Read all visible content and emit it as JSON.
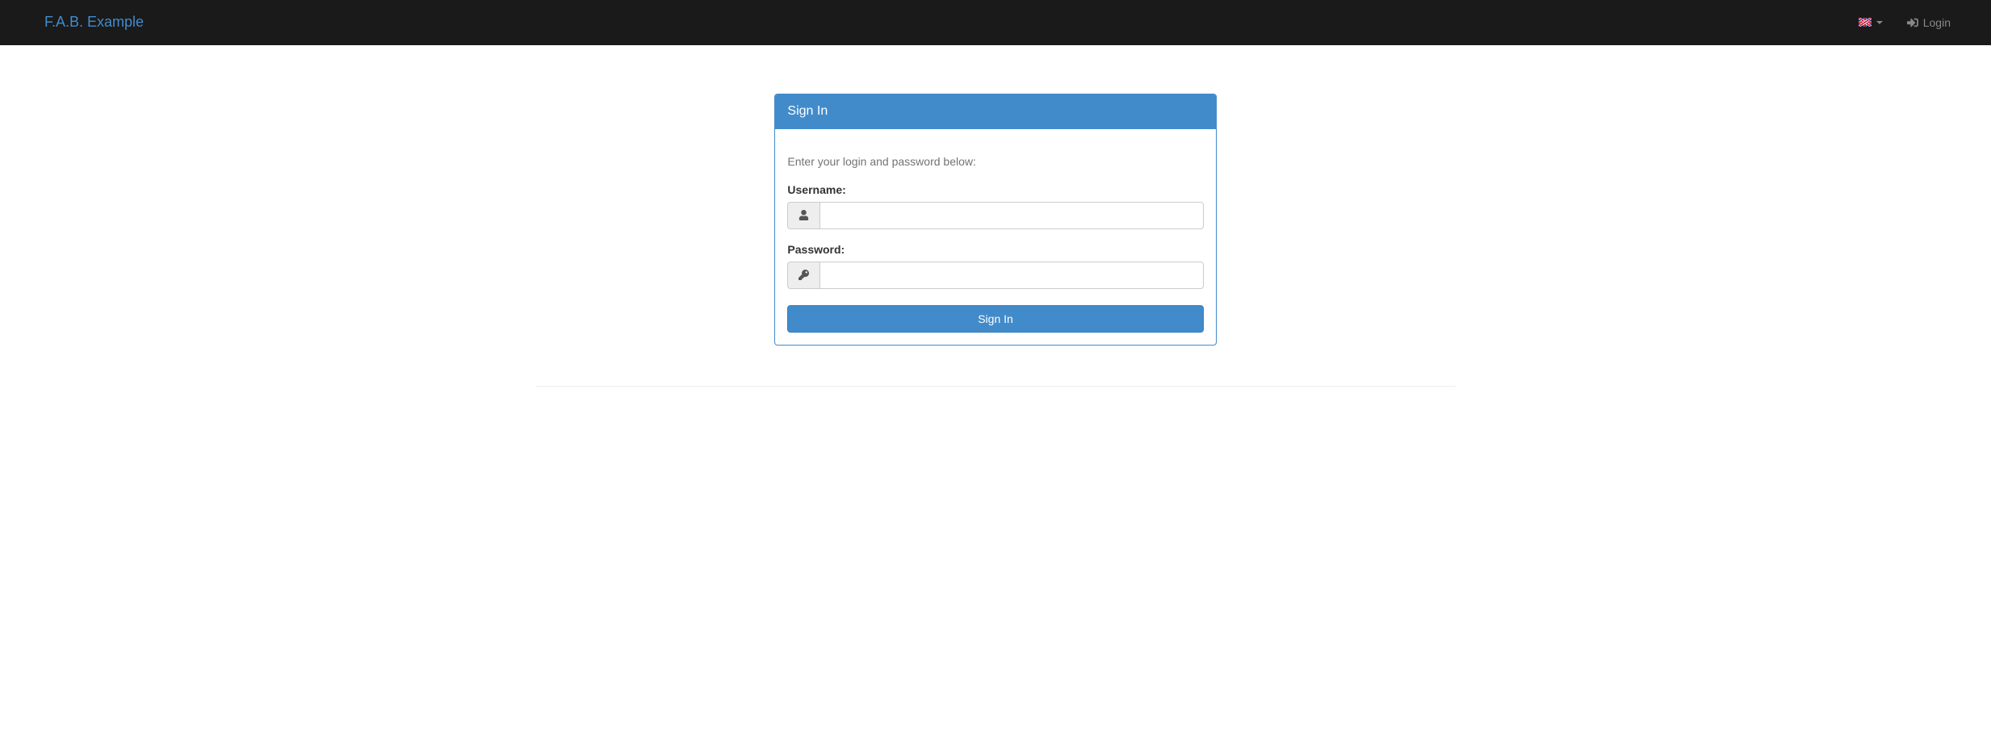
{
  "navbar": {
    "brand": "F.A.B. Example",
    "login_label": "Login"
  },
  "panel": {
    "title": "Sign In",
    "help_text": "Enter your login and password below:",
    "username_label": "Username:",
    "username_value": "",
    "password_label": "Password:",
    "password_value": "",
    "submit_label": "Sign In"
  }
}
